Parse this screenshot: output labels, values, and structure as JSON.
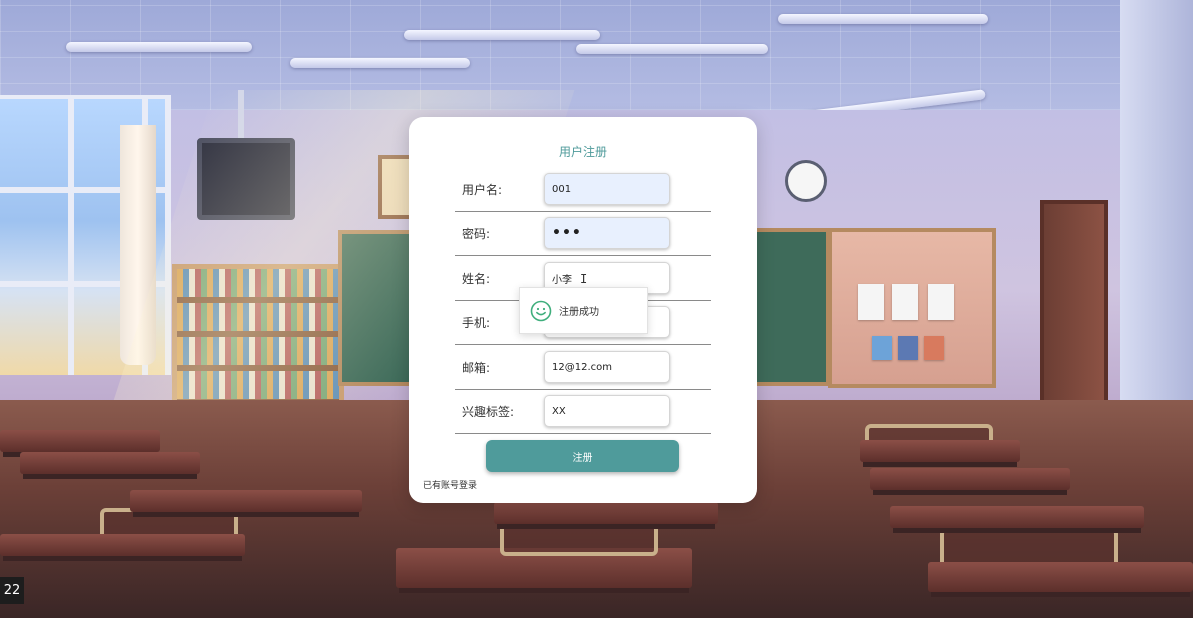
{
  "form": {
    "title": "用户注册",
    "fields": [
      {
        "label": "用户名:",
        "value": "001"
      },
      {
        "label": "密码:",
        "value": "•••"
      },
      {
        "label": "姓名:",
        "value": "小李"
      },
      {
        "label": "手机:",
        "value": ""
      },
      {
        "label": "邮箱:",
        "value": "12@12.com"
      },
      {
        "label": "兴趣标签:",
        "value": "XX"
      }
    ],
    "submit_label": "注册",
    "login_link": "已有账号登录"
  },
  "toast": {
    "icon": "smile-icon",
    "message": "注册成功",
    "color": "#3fae7c"
  },
  "corner_badge": "22",
  "theme": {
    "accent": "#4f9b9b"
  }
}
